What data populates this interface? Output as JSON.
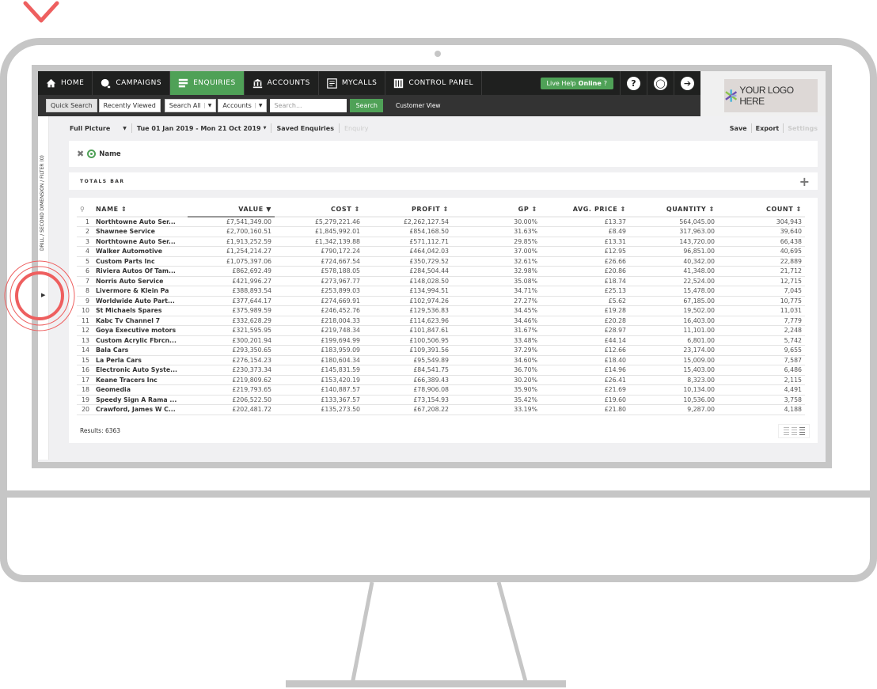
{
  "nav": {
    "items": [
      {
        "label": "HOME",
        "icon": "home-icon",
        "active": false
      },
      {
        "label": "CAMPAIGNS",
        "icon": "campaigns-icon",
        "active": false
      },
      {
        "label": "ENQUIRIES",
        "icon": "enquiries-icon",
        "active": true
      },
      {
        "label": "ACCOUNTS",
        "icon": "bank-icon",
        "active": false
      },
      {
        "label": "MYCALLS",
        "icon": "calls-icon",
        "active": false
      },
      {
        "label": "CONTROL PANEL",
        "icon": "control-panel-icon",
        "active": false
      }
    ],
    "live_help": "Live Help",
    "live_help_status": "Online",
    "icons": [
      "help-icon",
      "user-icon",
      "logout-icon"
    ],
    "accent": "#4fa157"
  },
  "subnav": {
    "quick_search": "Quick Search",
    "recently_viewed": "Recently Viewed",
    "search_all": "Search All",
    "accounts": "Accounts",
    "search_placeholder": "Search...",
    "search_button": "Search",
    "customer_view": "Customer View"
  },
  "logo": {
    "text": "YOUR LOGO HERE"
  },
  "sidebar": {
    "label": "DRILL / SECOND DIMENSION / FILTER (0)"
  },
  "filter": {
    "view": "Full Picture",
    "date_range": "Tue 01 Jan 2019 - Mon 21 Oct 2019",
    "saved": "Saved Enquiries",
    "enquiry": "Enquiry",
    "save": "Save",
    "export": "Export",
    "settings": "Settings"
  },
  "dimension": {
    "label": "Name"
  },
  "totals": {
    "label": "TOTALS BAR"
  },
  "table": {
    "columns": [
      "NAME",
      "VALUE",
      "COST",
      "PROFIT",
      "GP",
      "AVG. PRICE",
      "QUANTITY",
      "COUNT"
    ],
    "sorted_column": "VALUE",
    "rows": [
      [
        "1",
        "Northtowne Auto Ser...",
        "£7,541,349.00",
        "£5,279,221.46",
        "£2,262,127.54",
        "30.00%",
        "£13.37",
        "564,045.00",
        "304,943"
      ],
      [
        "2",
        "Shawnee Service",
        "£2,700,160.51",
        "£1,845,992.01",
        "£854,168.50",
        "31.63%",
        "£8.49",
        "317,963.00",
        "39,640"
      ],
      [
        "3",
        "Northtowne Auto Ser...",
        "£1,913,252.59",
        "£1,342,139.88",
        "£571,112.71",
        "29.85%",
        "£13.31",
        "143,720.00",
        "66,438"
      ],
      [
        "4",
        "Walker Automotive",
        "£1,254,214.27",
        "£790,172.24",
        "£464,042.03",
        "37.00%",
        "£12.95",
        "96,851.00",
        "40,695"
      ],
      [
        "5",
        "Custom Parts Inc",
        "£1,075,397.06",
        "£724,667.54",
        "£350,729.52",
        "32.61%",
        "£26.66",
        "40,342.00",
        "22,889"
      ],
      [
        "6",
        "Riviera Autos Of Tam...",
        "£862,692.49",
        "£578,188.05",
        "£284,504.44",
        "32.98%",
        "£20.86",
        "41,348.00",
        "21,712"
      ],
      [
        "7",
        "Norris Auto Service",
        "£421,996.27",
        "£273,967.77",
        "£148,028.50",
        "35.08%",
        "£18.74",
        "22,524.00",
        "12,715"
      ],
      [
        "8",
        "Livermore & Klein Pa",
        "£388,893.54",
        "£253,899.03",
        "£134,994.51",
        "34.71%",
        "£25.13",
        "15,478.00",
        "7,045"
      ],
      [
        "9",
        "Worldwide Auto Part...",
        "£377,644.17",
        "£274,669.91",
        "£102,974.26",
        "27.27%",
        "£5.62",
        "67,185.00",
        "10,775"
      ],
      [
        "10",
        "St Michaels Spares",
        "£375,989.59",
        "£246,452.76",
        "£129,536.83",
        "34.45%",
        "£19.28",
        "19,502.00",
        "11,031"
      ],
      [
        "11",
        "Kabc Tv Channel 7",
        "£332,628.29",
        "£218,004.33",
        "£114,623.96",
        "34.46%",
        "£20.28",
        "16,403.00",
        "7,779"
      ],
      [
        "12",
        "Goya Executive motors",
        "£321,595.95",
        "£219,748.34",
        "£101,847.61",
        "31.67%",
        "£28.97",
        "11,101.00",
        "2,248"
      ],
      [
        "13",
        "Custom Acrylic Fbrcn...",
        "£300,201.94",
        "£199,694.99",
        "£100,506.95",
        "33.48%",
        "£44.14",
        "6,801.00",
        "5,742"
      ],
      [
        "14",
        "Bala Cars",
        "£293,350.65",
        "£183,959.09",
        "£109,391.56",
        "37.29%",
        "£12.66",
        "23,174.00",
        "9,655"
      ],
      [
        "15",
        "La Perla Cars",
        "£276,154.23",
        "£180,604.34",
        "£95,549.89",
        "34.60%",
        "£18.40",
        "15,009.00",
        "7,587"
      ],
      [
        "16",
        "Electronic Auto Syste...",
        "£230,373.34",
        "£145,831.59",
        "£84,541.75",
        "36.70%",
        "£14.96",
        "15,403.00",
        "6,486"
      ],
      [
        "17",
        "Keane Tracers Inc",
        "£219,809.62",
        "£153,420.19",
        "£66,389.43",
        "30.20%",
        "£26.41",
        "8,323.00",
        "2,115"
      ],
      [
        "18",
        "Geomedia",
        "£219,793.65",
        "£140,887.57",
        "£78,906.08",
        "35.90%",
        "£21.69",
        "10,134.00",
        "4,491"
      ],
      [
        "19",
        "Speedy Sign A Rama ...",
        "£206,522.50",
        "£133,367.57",
        "£73,154.93",
        "35.42%",
        "£19.60",
        "10,536.00",
        "3,758"
      ],
      [
        "20",
        "Crawford, James W C...",
        "£202,481.72",
        "£135,273.50",
        "£67,208.22",
        "33.19%",
        "£21.80",
        "9,287.00",
        "4,188"
      ]
    ]
  },
  "footer": {
    "results": "Results: 6363"
  }
}
